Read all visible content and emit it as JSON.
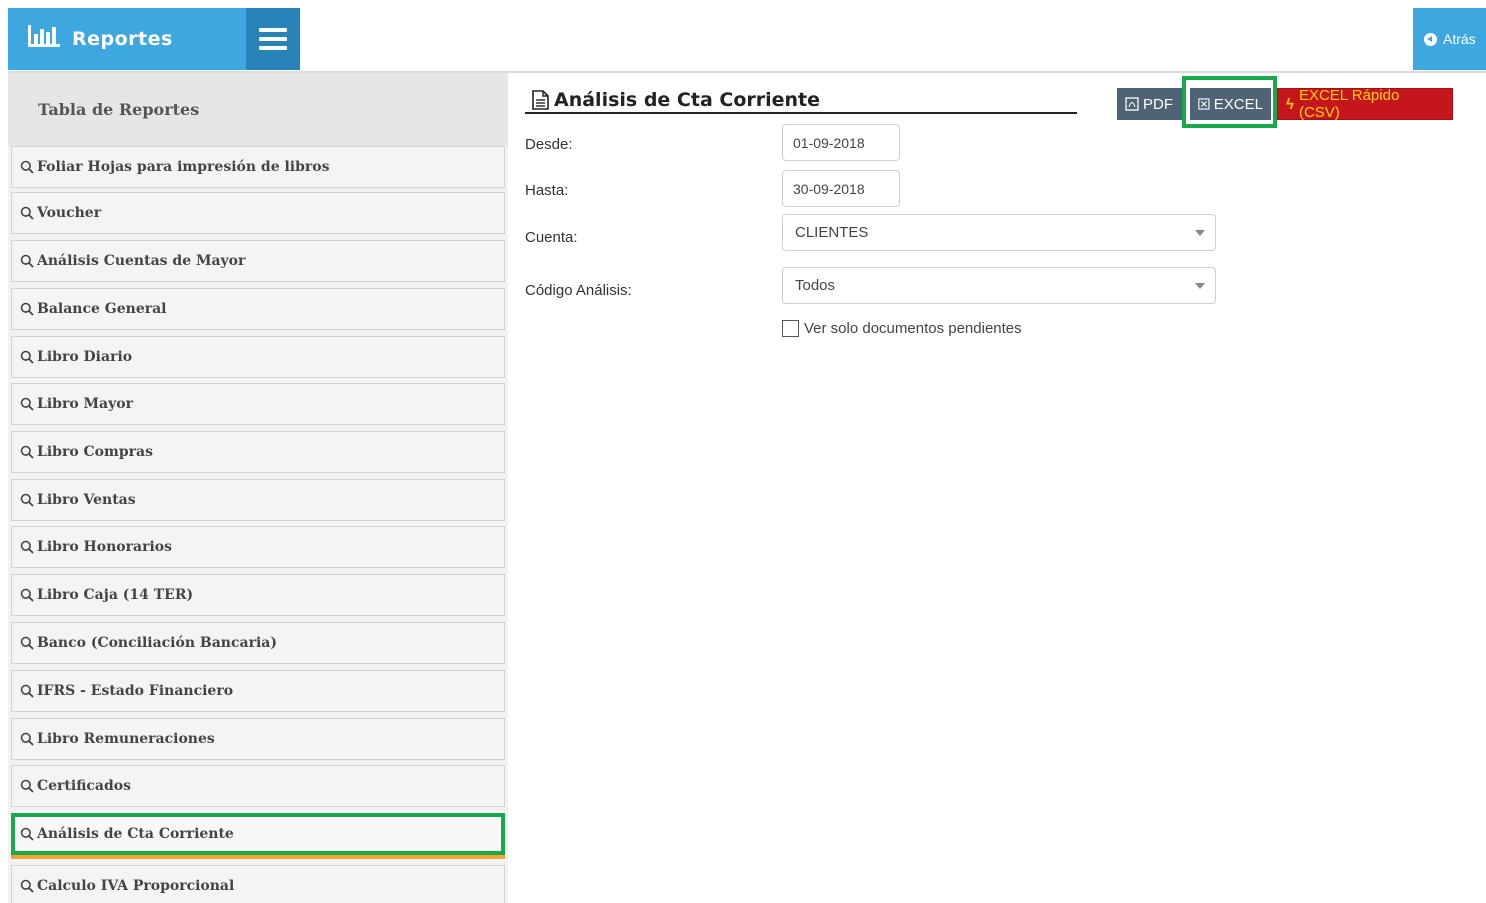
{
  "header": {
    "brand": "Reportes",
    "back_label": "Atrás"
  },
  "sidebar": {
    "title": "Tabla de Reportes",
    "items": [
      {
        "label": "Foliar Hojas para impresión de libros"
      },
      {
        "label": "Voucher"
      },
      {
        "label": "Análisis Cuentas de Mayor"
      },
      {
        "label": "Balance General"
      },
      {
        "label": "Libro Diario"
      },
      {
        "label": "Libro Mayor"
      },
      {
        "label": "Libro Compras"
      },
      {
        "label": "Libro Ventas"
      },
      {
        "label": "Libro Honorarios"
      },
      {
        "label": "Libro Caja (14 TER)"
      },
      {
        "label": "Banco (Conciliación Bancaria)"
      },
      {
        "label": "IFRS - Estado Financiero"
      },
      {
        "label": "Libro Remuneraciones"
      },
      {
        "label": "Certificados"
      },
      {
        "label": "Análisis de Cta Corriente",
        "active": true
      },
      {
        "label": "Calculo IVA Proporcional"
      }
    ]
  },
  "main": {
    "title": "Análisis de Cta Corriente",
    "buttons": {
      "pdf": "PDF",
      "excel": "EXCEL",
      "csv": "EXCEL Rápido (CSV)"
    },
    "form": {
      "desde_label": "Desde:",
      "desde_value": "01-09-2018",
      "hasta_label": "Hasta:",
      "hasta_value": "30-09-2018",
      "cuenta_label": "Cuenta:",
      "cuenta_value": "CLIENTES",
      "codigo_label": "Código Análisis:",
      "codigo_value": "Todos",
      "checkbox_label": "Ver solo documentos pendientes"
    }
  },
  "colors": {
    "brand": "#3ca8df",
    "menu": "#2a83b8",
    "highlight": "#19a84b",
    "csv_bg": "#c4161c",
    "csv_text": "#ffd200",
    "dark_btn": "#4f6276"
  }
}
